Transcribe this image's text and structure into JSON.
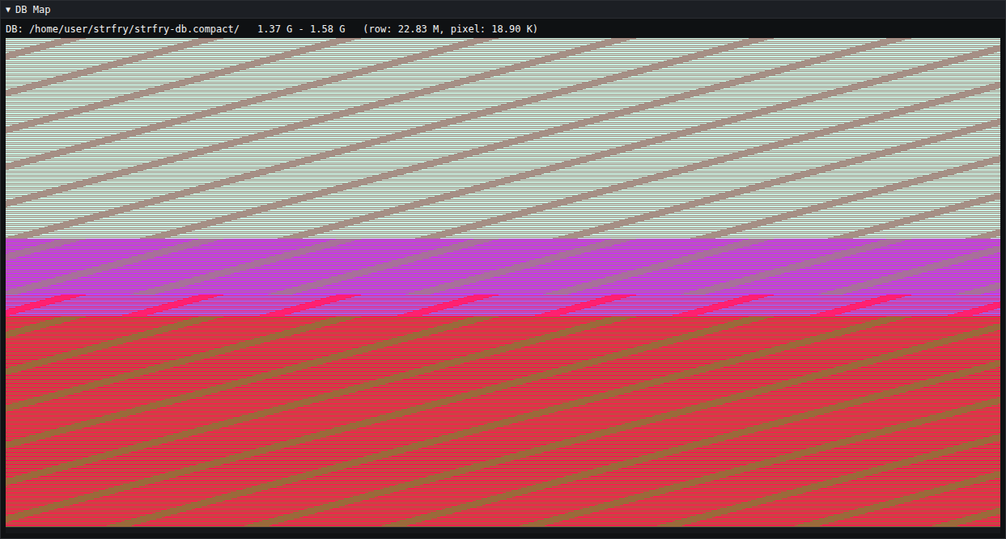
{
  "window": {
    "title": "DB Map",
    "collapse_icon": "▼",
    "expanded": true
  },
  "info": {
    "path": "DB: /home/user/strfry/strfry-db.compact/",
    "range": "1.37 G - 1.58 G",
    "scale": "(row: 22.83 M, pixel: 18.90 K)"
  },
  "map": {
    "bands": [
      {
        "level": 0.41,
        "colors": [
          "#c8f2e2",
          "#a58f85"
        ]
      },
      {
        "level": 0.114,
        "colors": [
          "#cc33ee",
          "#a8709a"
        ]
      },
      {
        "level": 0.045,
        "colors": [
          "#9a66ee",
          "#ff2070"
        ]
      },
      {
        "level": 0.431,
        "colors": [
          "#ff1a50",
          "#9a6a3a"
        ]
      }
    ]
  }
}
